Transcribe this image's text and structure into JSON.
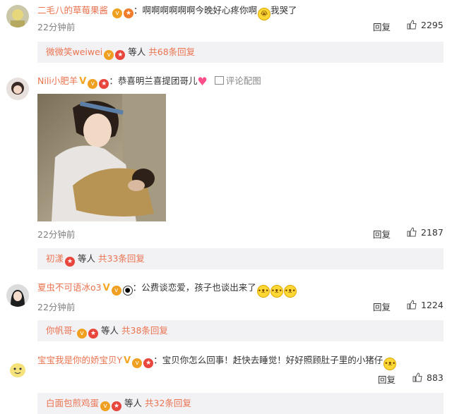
{
  "comments": [
    {
      "username": "二毛八的草莓果酱",
      "text": "啊啊啊啊啊啊今晚好心疼你啊",
      "text_suffix": "我哭了",
      "time": "22分钟前",
      "reply_label": "回复",
      "likes": "2295",
      "sub": {
        "name": "微微笑weiwei",
        "etc": "等人",
        "more": "共68条回复"
      }
    },
    {
      "username": "Nili小肥羊",
      "text": "恭喜明兰喜提团哥儿",
      "pic_link": "评论配图",
      "time": "22分钟前",
      "reply_label": "回复",
      "likes": "2187",
      "sub": {
        "name": "初漾",
        "etc": "等人",
        "more": "共33条回复"
      }
    },
    {
      "username": "夏虫不可语冰o3",
      "text": "公费谈恋爱，孩子也谈出来了",
      "time": "22分钟前",
      "reply_label": "回复",
      "likes": "1224",
      "sub": {
        "name": "你帆哥-",
        "etc": "等人",
        "more": "共38条回复"
      }
    },
    {
      "username": "宝宝我是你的娇宝贝Y",
      "text": "宝贝你怎么回事！赶快去睡觉！好好照顾肚子里的小猪仔",
      "time": "22分钟前",
      "reply_label": "回复",
      "likes": "883",
      "sub": {
        "name": "白面包煎鸡蛋",
        "etc": "等人",
        "more": "共32条回复"
      }
    }
  ],
  "colors": {
    "username": "#eb7350",
    "subbox_bg": "#f2f2f5",
    "time": "#808080"
  }
}
